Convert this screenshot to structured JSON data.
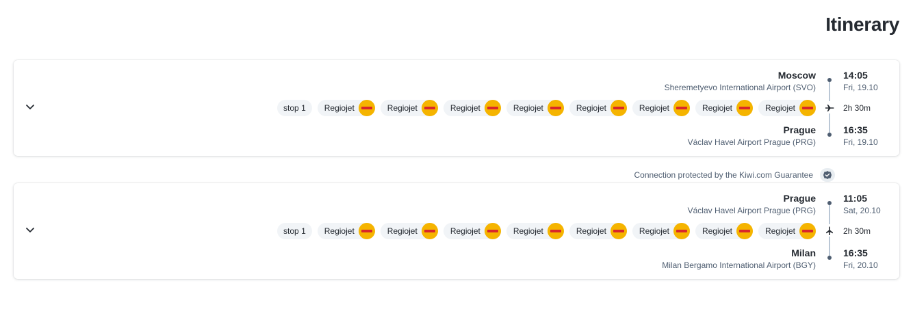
{
  "page": {
    "title": "Itinerary"
  },
  "segments": [
    {
      "origin": {
        "city": "Moscow",
        "airport": "Sheremetyevo International Airport (SVO)",
        "time": "14:05",
        "date": "Fri, 19.10"
      },
      "destination": {
        "city": "Prague",
        "airport": "Václav Havel Airport Prague (PRG)",
        "time": "16:35",
        "date": "Fri, 19.10"
      },
      "duration": "2h 30m",
      "stop_label": "stop 1",
      "carriers": [
        "Regiojet",
        "Regiojet",
        "Regiojet",
        "Regiojet",
        "Regiojet",
        "Regiojet",
        "Regiojet",
        "Regiojet"
      ]
    },
    {
      "origin": {
        "city": "Prague",
        "airport": "Václav Havel Airport Prague (PRG)",
        "time": "11:05",
        "date": "Sat, 20.10"
      },
      "destination": {
        "city": "Milan",
        "airport": "Milan Bergamo International Airport (BGY)",
        "time": "16:35",
        "date": "Fri, 20.10"
      },
      "duration": "2h 30m",
      "stop_label": "stop 1",
      "carriers": [
        "Regiojet",
        "Regiojet",
        "Regiojet",
        "Regiojet",
        "Regiojet",
        "Regiojet",
        "Regiojet",
        "Regiojet"
      ]
    }
  ],
  "guarantee": {
    "text": "Connection protected by the Kiwi.com Guarantee",
    "icon": "shield-check-icon"
  },
  "icons": {
    "expand": "chevron-down-icon",
    "plane": "plane-icon",
    "carrier_logo": "regiojet-logo"
  },
  "colors": {
    "text_primary": "#252a31",
    "text_secondary": "#4f5e71",
    "chip_bg": "#f1f4f7",
    "carrier_logo_bg": "#f5b400",
    "timeline": "#bac7d5"
  }
}
